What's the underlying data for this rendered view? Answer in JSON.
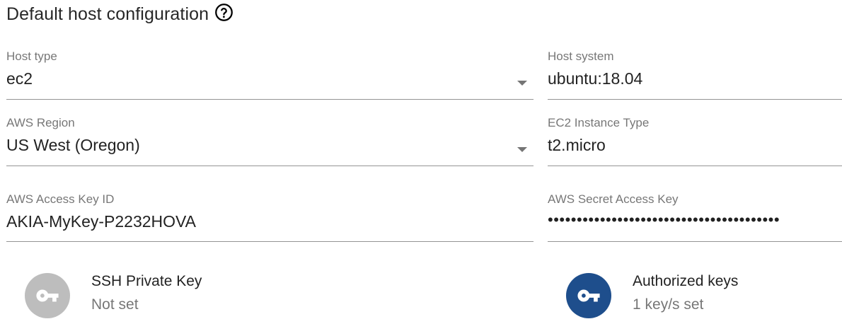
{
  "section": {
    "title": "Default host configuration",
    "help_icon": "help-circle-outline-icon"
  },
  "fields": {
    "host_type": {
      "label": "Host type",
      "value": "ec2"
    },
    "host_system": {
      "label": "Host system",
      "value": "ubuntu:18.04"
    },
    "aws_region": {
      "label": "AWS Region",
      "value": "US West (Oregon)"
    },
    "ec2_instance_type": {
      "label": "EC2 Instance Type",
      "value": "t2.micro"
    },
    "aws_access_key_id": {
      "label": "AWS Access Key ID",
      "value": "AKIA-MyKey-P2232HOVA"
    },
    "aws_secret_access_key": {
      "label": "AWS Secret Access Key",
      "value": "••••••••••••••••••••••••••••••••••••••••"
    }
  },
  "keys": {
    "ssh_private_key": {
      "title": "SSH Private Key",
      "status": "Not set",
      "icon": "vpn-key-icon",
      "color": "#bdbdbd"
    },
    "authorized_keys": {
      "title": "Authorized keys",
      "status": "1 key/s set",
      "icon": "vpn-key-icon",
      "color": "#1e4e8c"
    }
  }
}
